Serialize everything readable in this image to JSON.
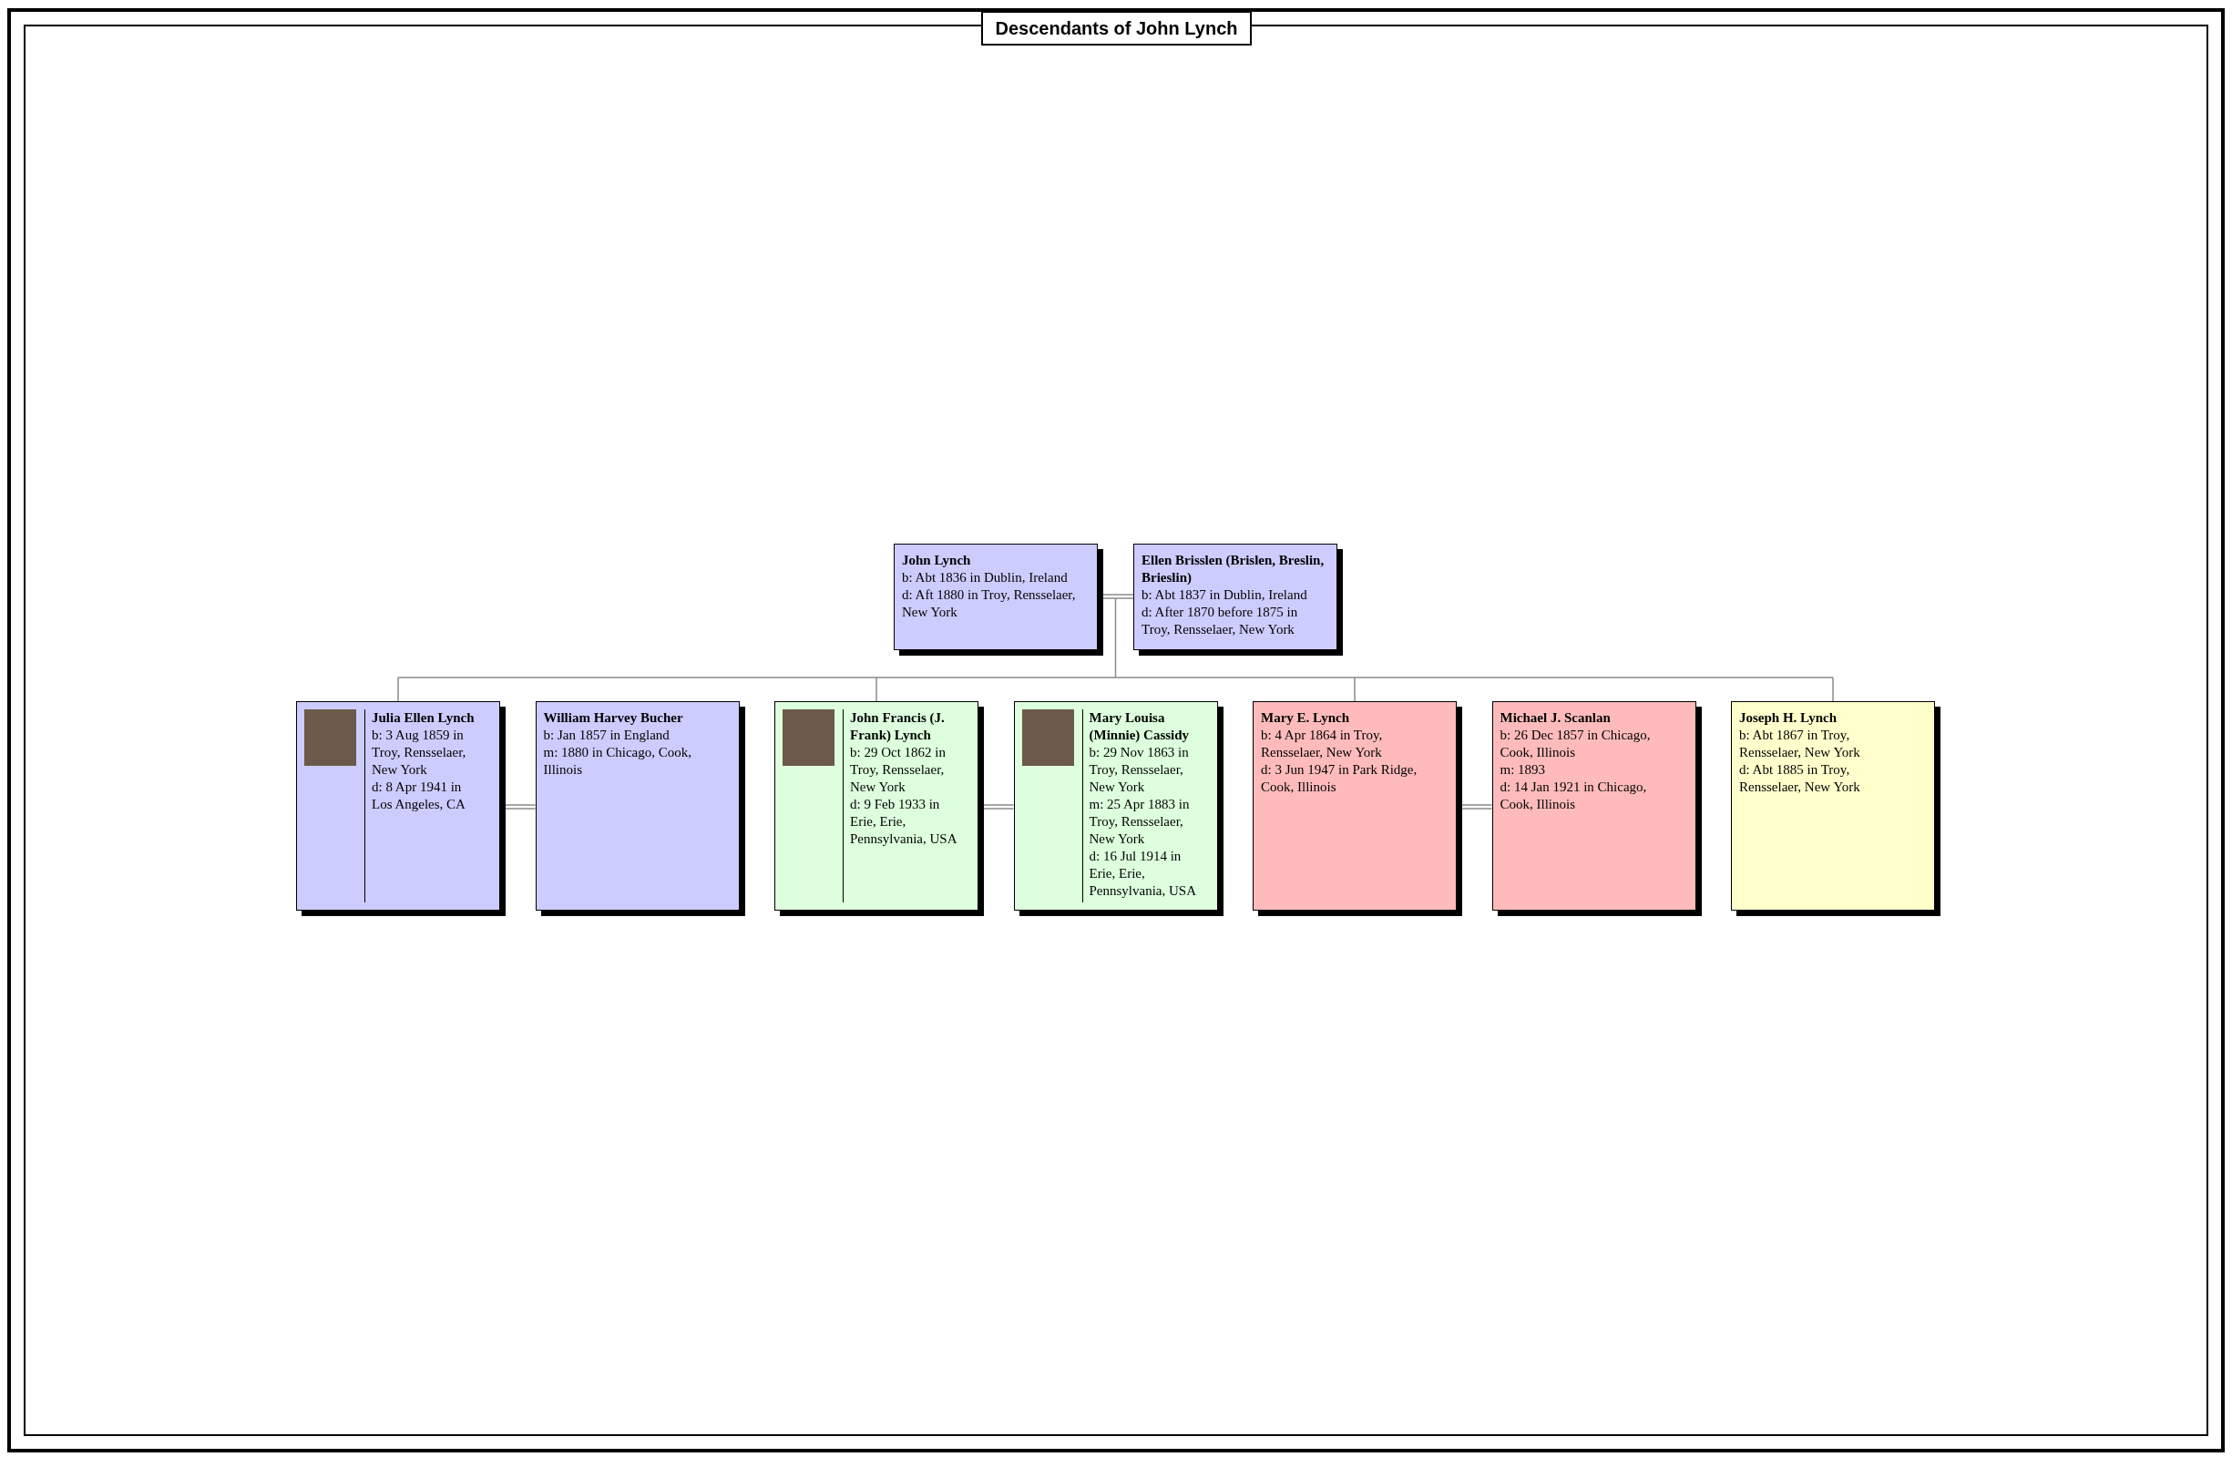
{
  "title": "Descendants of John Lynch",
  "couple": [
    {
      "name": "John Lynch",
      "color": "#ccccff",
      "photo": false,
      "facts": [
        "b: Abt 1836 in Dublin, Ireland",
        "d: Aft 1880 in Troy, Rensselaer, New York"
      ]
    },
    {
      "name": "Ellen Brisslen (Brislen, Breslin, Brieslin)",
      "color": "#ccccff",
      "photo": false,
      "facts": [
        "b: Abt 1837 in Dublin, Ireland",
        "d: After 1870 before 1875 in Troy, Rensselaer, New York"
      ]
    }
  ],
  "children": [
    {
      "person": {
        "name": "Julia Ellen Lynch",
        "color": "#ccccff",
        "photo": true,
        "facts": [
          "b: 3 Aug 1859 in Troy, Rensselaer, New York",
          "d: 8 Apr 1941 in Los Angeles, CA"
        ]
      },
      "spouse": {
        "name": "William Harvey Bucher",
        "color": "#ccccff",
        "photo": false,
        "facts": [
          "b: Jan 1857 in England",
          "m: 1880 in Chicago, Cook, Illinois"
        ]
      }
    },
    {
      "person": {
        "name": "John Francis (J. Frank) Lynch",
        "color": "#ddffdd",
        "photo": true,
        "facts": [
          "b: 29 Oct 1862 in Troy, Rensselaer, New York",
          "d: 9 Feb 1933 in Erie, Erie, Pennsylvania, USA"
        ]
      },
      "spouse": {
        "name": "Mary Louisa (Minnie) Cassidy",
        "color": "#ddffdd",
        "photo": true,
        "facts": [
          "b: 29 Nov 1863 in Troy, Rensselaer, New York",
          "m: 25 Apr 1883 in Troy, Rensselaer, New York",
          "d: 16 Jul 1914 in Erie, Erie, Pennsylvania, USA"
        ]
      }
    },
    {
      "person": {
        "name": "Mary E. Lynch",
        "color": "#ffbbbb",
        "photo": false,
        "facts": [
          "b: 4 Apr 1864 in Troy, Rensselaer, New York",
          "d: 3 Jun 1947 in Park Ridge, Cook, Illinois"
        ]
      },
      "spouse": {
        "name": "Michael J. Scanlan",
        "color": "#ffbbbb",
        "photo": false,
        "facts": [
          "b: 26 Dec 1857 in Chicago, Cook, Illinois",
          "m: 1893",
          "d: 14 Jan 1921 in Chicago, Cook, Illinois"
        ]
      }
    },
    {
      "person": {
        "name": "Joseph H. Lynch",
        "color": "#ffffcc",
        "photo": false,
        "facts": [
          "b: Abt 1867 in Troy, Rensselaer, New York",
          "d: Abt 1885 in Troy, Rensselaer, New York"
        ]
      }
    }
  ]
}
